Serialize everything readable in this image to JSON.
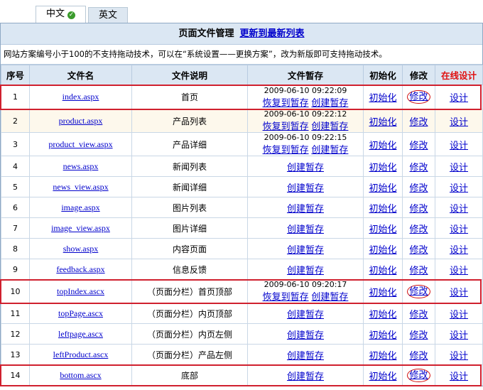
{
  "tabs": [
    {
      "label": "中文",
      "active": true
    },
    {
      "label": "英文",
      "active": false
    }
  ],
  "header": {
    "title": "页面文件管理",
    "update_link": "更新到最新列表"
  },
  "notice": "网站方案编号小于100的不支持拖动技术，可以在“系统设置——更换方案”，改为新版即可支持拖动技术。",
  "columns": [
    "序号",
    "文件名",
    "文件说明",
    "文件暂存",
    "初始化",
    "修改",
    "在线设计"
  ],
  "actions": {
    "restore": "恢复到暂存",
    "create": "创建暂存",
    "init": "初始化",
    "edit": "修改",
    "design": "设计"
  },
  "rows": [
    {
      "no": "1",
      "file": "index.aspx",
      "desc": "首页",
      "ts": "2009-06-10 09:22:09"
    },
    {
      "no": "2",
      "file": "product.aspx",
      "desc": "产品列表",
      "ts": "2009-06-10 09:22:12"
    },
    {
      "no": "3",
      "file": "product_view.aspx",
      "desc": "产品详细",
      "ts": "2009-06-10 09:22:15"
    },
    {
      "no": "4",
      "file": "news.aspx",
      "desc": "新闻列表",
      "ts": ""
    },
    {
      "no": "5",
      "file": "news_view.aspx",
      "desc": "新闻详细",
      "ts": ""
    },
    {
      "no": "6",
      "file": "image.aspx",
      "desc": "图片列表",
      "ts": ""
    },
    {
      "no": "7",
      "file": "image_view.aspx",
      "desc": "图片详细",
      "ts": ""
    },
    {
      "no": "8",
      "file": "show.aspx",
      "desc": "内容页面",
      "ts": ""
    },
    {
      "no": "9",
      "file": "feedback.aspx",
      "desc": "信息反馈",
      "ts": ""
    },
    {
      "no": "10",
      "file": "topIndex.ascx",
      "desc": "（页面分栏）首页顶部",
      "ts": "2009-06-10 09:20:17"
    },
    {
      "no": "11",
      "file": "topPage.ascx",
      "desc": "（页面分栏）内页顶部",
      "ts": ""
    },
    {
      "no": "12",
      "file": "leftpage.ascx",
      "desc": "（页面分栏）内页左侧",
      "ts": ""
    },
    {
      "no": "13",
      "file": "leftProduct.ascx",
      "desc": "（页面分栏）产品左侧",
      "ts": ""
    },
    {
      "no": "14",
      "file": "bottom.ascx",
      "desc": "底部",
      "ts": ""
    }
  ],
  "highlighted_rows": [
    "1",
    "10",
    "14"
  ],
  "colors": {
    "link": "#0000cc",
    "highlight": "#d0202e",
    "header_bg": "#dbe7f3",
    "alt_row": "#fdf8ec"
  }
}
